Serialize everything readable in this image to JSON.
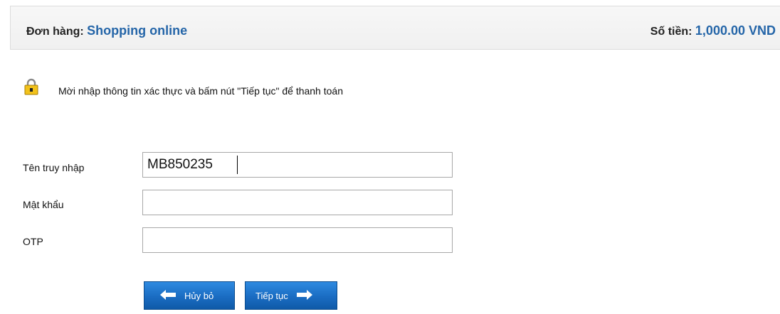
{
  "order": {
    "label": "Đơn hàng:",
    "name": "Shopping online",
    "amount_label": "Số tiền:",
    "amount": "1,000.00 VND"
  },
  "notice": {
    "icon": "lock-icon",
    "text": "Mời nhập thông tin xác thực và bấm nút \"Tiếp tục\" để thanh toán"
  },
  "form": {
    "username_label": "Tên truy nhập",
    "username_value": "MB850235",
    "password_label": "Mật khẩu",
    "password_value": "",
    "otp_label": "OTP",
    "otp_value": ""
  },
  "buttons": {
    "cancel_label": "Hủy bỏ",
    "continue_label": "Tiếp tục"
  },
  "colors": {
    "accent": "#2465a8",
    "button": "#1a6cc2"
  }
}
